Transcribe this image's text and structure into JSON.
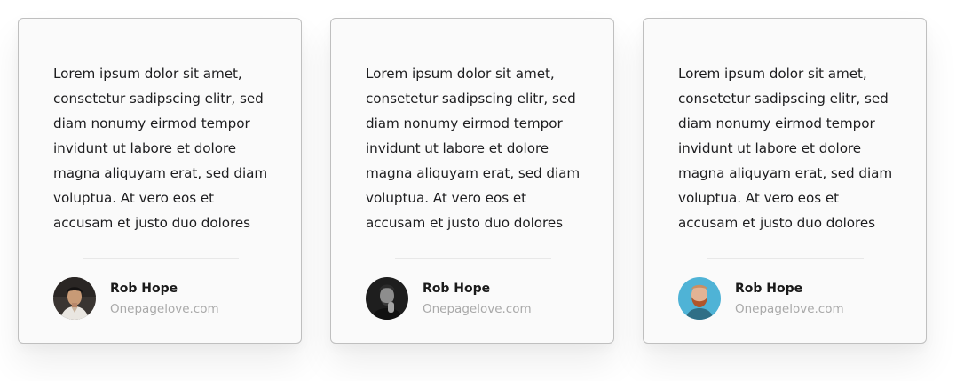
{
  "testimonials": [
    {
      "quote": "Lorem ipsum dolor sit amet, consetetur sadipscing elitr, sed diam nonumy eirmod tempor invidunt ut labore et dolore magna aliquyam erat, sed diam voluptua. At vero eos et accusam et justo duo dolores",
      "name": "Rob Hope",
      "site": "Onepagelove.com",
      "avatar": "portrait-man-dark-hair"
    },
    {
      "quote": "Lorem ipsum dolor sit amet, consetetur sadipscing elitr, sed diam nonumy eirmod tempor invidunt ut labore et dolore magna aliquyam erat, sed diam voluptua. At vero eos et accusam et justo duo dolores",
      "name": "Rob Hope",
      "site": "Onepagelove.com",
      "avatar": "portrait-man-bw-hand-on-chin"
    },
    {
      "quote": "Lorem ipsum dolor sit amet, consetetur sadipscing elitr, sed diam nonumy eirmod tempor invidunt ut labore et dolore magna aliquyam erat, sed diam voluptua. At vero eos et accusam et justo duo dolores",
      "name": "Rob Hope",
      "site": "Onepagelove.com",
      "avatar": "portrait-man-red-beard-blue-bg"
    }
  ],
  "colors": {
    "card_border": "#bfbfbf",
    "card_bg": "#fafafa",
    "text": "#1d1d1f",
    "muted": "#a9a9a9"
  }
}
